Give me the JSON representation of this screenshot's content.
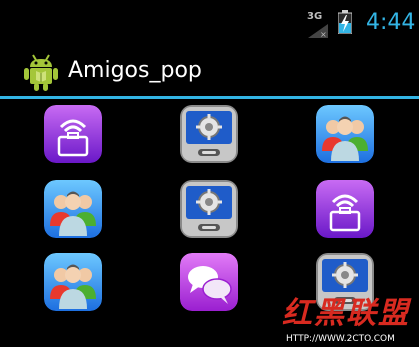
{
  "status_bar": {
    "network_label": "3G",
    "time": "4:44",
    "accent_color": "#33b5e5"
  },
  "action_bar": {
    "title": "Amigos_pop",
    "app_icon": "android-robot-icon"
  },
  "grid": {
    "tiles": [
      {
        "icon": "wifi-briefcase-icon",
        "color": "#8a2be2"
      },
      {
        "icon": "settings-device-icon",
        "color": "#2f6fd6"
      },
      {
        "icon": "contacts-group-icon",
        "color": "#2a8cff"
      },
      {
        "icon": "contacts-group-icon",
        "color": "#2a8cff"
      },
      {
        "icon": "settings-device-icon",
        "color": "#2f6fd6"
      },
      {
        "icon": "wifi-briefcase-icon",
        "color": "#8a2be2"
      },
      {
        "icon": "contacts-group-icon",
        "color": "#2a8cff"
      },
      {
        "icon": "chat-bubbles-icon",
        "color": "#b233d8"
      },
      {
        "icon": "settings-device-icon",
        "color": "#2f6fd6"
      }
    ]
  },
  "watermark": {
    "characters": "红黑联盟",
    "url": "HTTP://WWW.2CTO.COM"
  }
}
